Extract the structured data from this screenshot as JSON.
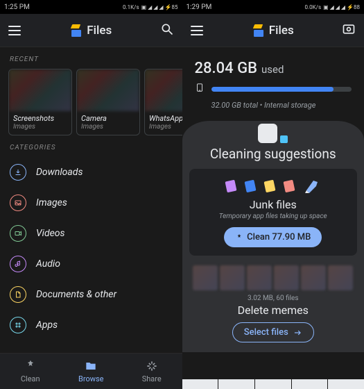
{
  "left": {
    "status": {
      "time": "1:25 PM",
      "net": "0.1K/s",
      "indicators": "▣ ◢ ◢ ◢ ⚡85"
    },
    "app_title": "Files",
    "sections": {
      "recent": "RECENT",
      "categories": "CATEGORIES"
    },
    "recent": [
      {
        "title": "Screenshots",
        "sub": "Images"
      },
      {
        "title": "Camera",
        "sub": "Images"
      },
      {
        "title": "WhatsApp",
        "sub": "Images"
      }
    ],
    "categories": [
      {
        "label": "Downloads",
        "color": "#8ab4f8",
        "icon": "download"
      },
      {
        "label": "Images",
        "color": "#f28b82",
        "icon": "image"
      },
      {
        "label": "Videos",
        "color": "#81c995",
        "icon": "video"
      },
      {
        "label": "Audio",
        "color": "#c58af9",
        "icon": "audio"
      },
      {
        "label": "Documents & other",
        "color": "#fdd663",
        "icon": "doc"
      },
      {
        "label": "Apps",
        "color": "#78d9ec",
        "icon": "app"
      }
    ],
    "nav": {
      "clean": "Clean",
      "browse": "Browse",
      "share": "Share",
      "active": "browse"
    }
  },
  "right": {
    "status": {
      "time": "1:29 PM",
      "net": "0.0K/s",
      "indicators": "▣ ◢ ◢ ◢ ⚡88"
    },
    "app_title": "Files",
    "storage": {
      "used_value": "28.04 GB",
      "used_label": "used",
      "total": "32.00 GB total",
      "location": "Internal storage",
      "fill_pct": 87
    },
    "cleaning": {
      "heading": "Cleaning suggestions",
      "junk": {
        "title": "Junk files",
        "subtitle": "Temporary app files taking up space",
        "button": "Clean 77.90 MB"
      },
      "memes": {
        "meta": "3.02 MB, 60 files",
        "title": "Delete memes",
        "button": "Select files"
      }
    }
  }
}
